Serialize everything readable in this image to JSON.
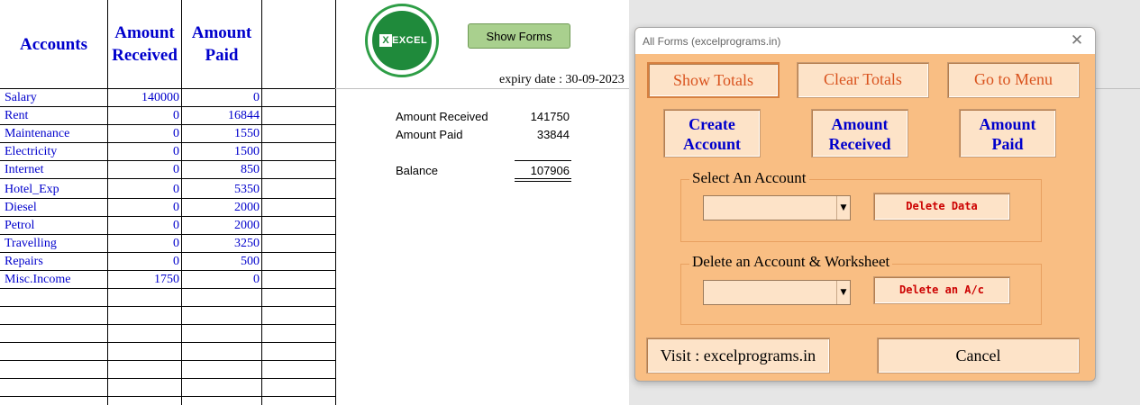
{
  "sheet": {
    "headers": {
      "accounts": "Accounts",
      "received_line1": "Amount",
      "received_line2": "Received",
      "paid_line1": "Amount",
      "paid_line2": "Paid"
    },
    "rows": [
      {
        "name": "Salary",
        "received": "140000",
        "paid": "0"
      },
      {
        "name": "Rent",
        "received": "0",
        "paid": "16844"
      },
      {
        "name": "Maintenance",
        "received": "0",
        "paid": "1550"
      },
      {
        "name": "Electricity",
        "received": "0",
        "paid": "1500"
      },
      {
        "name": "Internet",
        "received": "0",
        "paid": "850"
      },
      {
        "name": "Hotel_Exp",
        "received": "0",
        "paid": "5350"
      },
      {
        "name": "Diesel",
        "received": "0",
        "paid": "2000"
      },
      {
        "name": "Petrol",
        "received": "0",
        "paid": "2000"
      },
      {
        "name": "Travelling",
        "received": "0",
        "paid": "3250"
      },
      {
        "name": "Repairs",
        "received": "0",
        "paid": "500"
      },
      {
        "name": "Misc.Income",
        "received": "1750",
        "paid": "0"
      }
    ],
    "logo_text": "EXCEL",
    "show_forms_label": "Show Forms",
    "expiry_text": "expiry date : 30-09-2023",
    "summary": {
      "received_label": "Amount Received",
      "received_value": "141750",
      "paid_label": "Amount Paid",
      "paid_value": "33844",
      "balance_label": "Balance",
      "balance_value": "107906"
    }
  },
  "dialog": {
    "title": "All Forms (excelprograms.in)",
    "close_glyph": "✕",
    "show_totals": "Show Totals",
    "clear_totals": "Clear Totals",
    "go_to_menu": "Go to Menu",
    "create_account_line1": "Create",
    "create_account_line2": "Account",
    "amount_received_line1": "Amount",
    "amount_received_line2": "Received",
    "amount_paid_line1": "Amount",
    "amount_paid_line2": "Paid",
    "select_account_title": "Select An Account",
    "select_account_value": "",
    "delete_data": "Delete Data",
    "delete_account_title": "Delete an Account & Worksheet",
    "delete_account_value": "",
    "delete_ac": "Delete an A/c",
    "visit": "Visit : excelprograms.in",
    "cancel": "Cancel",
    "combo_arrow": "▼"
  },
  "colors": {
    "dialog_bg": "#f9be83",
    "button_bg": "#fde3c8",
    "header_text": "#0000cc",
    "orange_text": "#d9531e",
    "delete_text": "#cc0000",
    "show_forms_bg": "#a9d08e"
  },
  "icons": {
    "logo": "excel-logo-icon",
    "close": "close-icon",
    "dropdown": "chevron-down-icon"
  }
}
